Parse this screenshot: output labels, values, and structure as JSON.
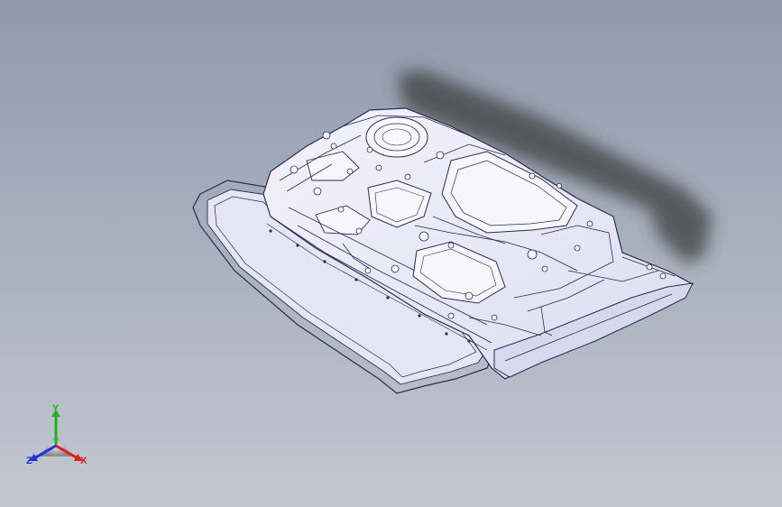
{
  "viewport": {
    "background_top": "#8e9aab",
    "background_bottom": "#c3c8d0"
  },
  "model": {
    "icon": "car-door-inner-panel-wireframe",
    "fill_color": "#ecebf8",
    "edge_color": "#2a2a55",
    "shadow_color": "#4a4a4a"
  },
  "triad": {
    "icon": "coordinate-triad-icon",
    "x_label": "X",
    "y_label": "Y",
    "z_label": "Z",
    "x_color": "#e02020",
    "y_color": "#20b020",
    "z_color": "#2030e0"
  }
}
